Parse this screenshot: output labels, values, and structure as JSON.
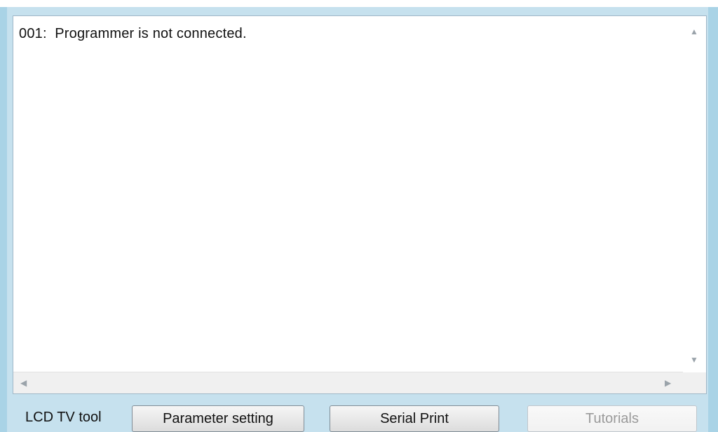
{
  "log": {
    "lines": [
      "001:  Programmer is not connected."
    ],
    "first_line": "001:  Programmer is not connected."
  },
  "scrollbars": {
    "up_icon": "▲",
    "down_icon": "▼",
    "left_icon": "◀",
    "right_icon": "▶"
  },
  "toolbar": {
    "label": "LCD TV tool",
    "parameter_setting": "Parameter setting",
    "serial_print": "Serial Print",
    "tutorials": "Tutorials"
  },
  "colors": {
    "window_frame": "#a9d3e6",
    "text": "#111111",
    "disabled_text": "#9a9a9a"
  }
}
